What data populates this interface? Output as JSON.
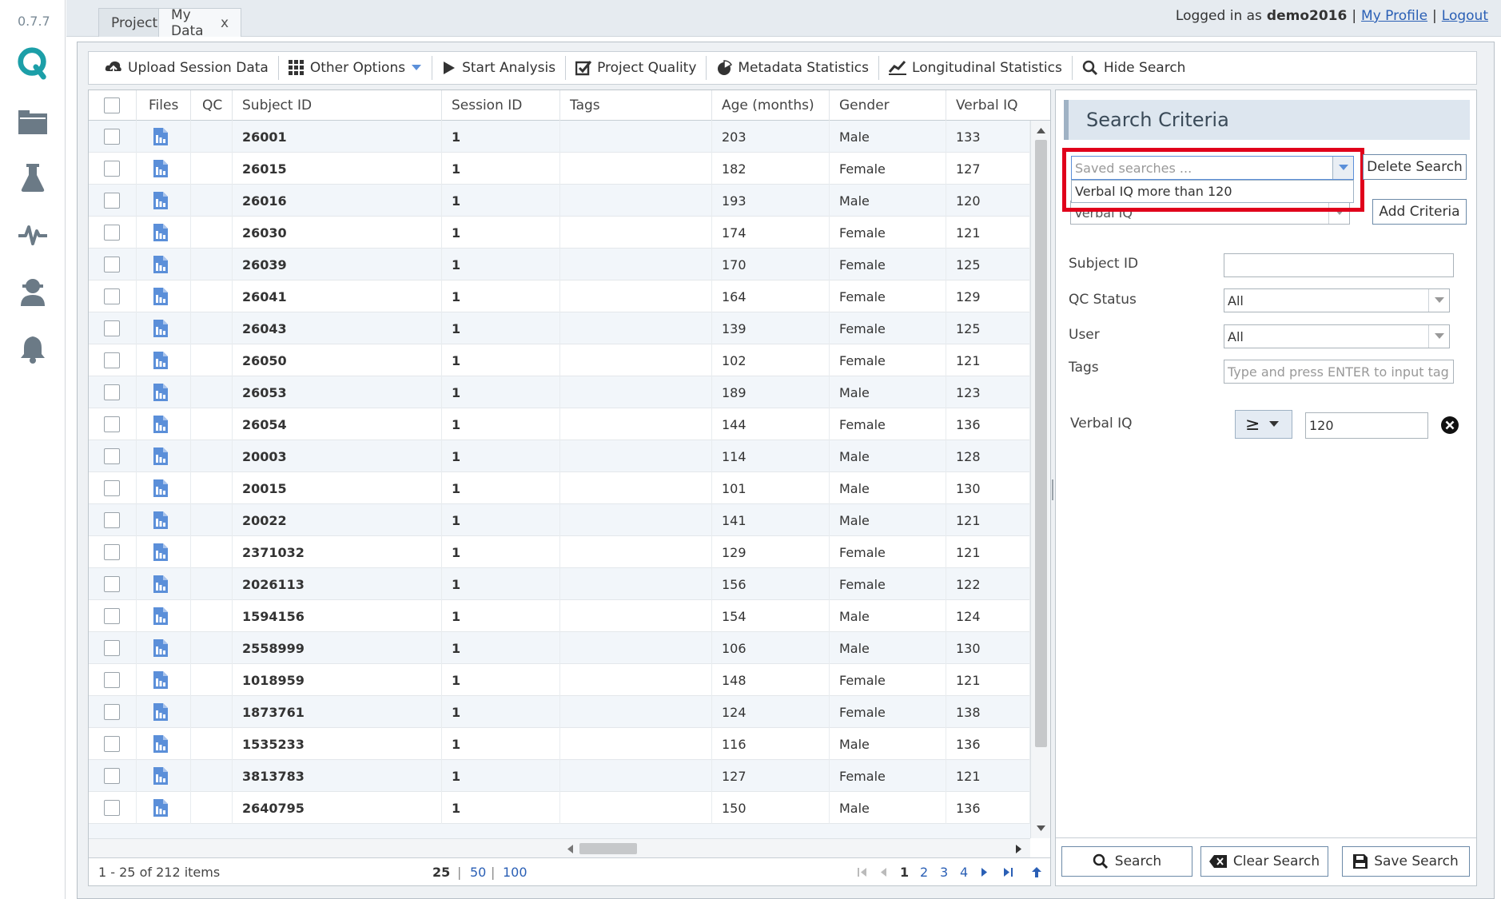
{
  "app": {
    "version": "0.7.7"
  },
  "tabs": [
    {
      "label": "Projects"
    },
    {
      "label": "My Data",
      "close": "x"
    }
  ],
  "login": {
    "prefix": "Logged in as",
    "user": "demo2016",
    "sep": "|",
    "profile": "My Profile",
    "logout": "Logout"
  },
  "toolbar": {
    "upload": "Upload Session Data",
    "other": "Other Options",
    "start": "Start Analysis",
    "quality": "Project Quality",
    "metadata": "Metadata Statistics",
    "longitudinal": "Longitudinal Statistics",
    "hide": "Hide Search"
  },
  "grid": {
    "columns": {
      "files": "Files",
      "qc": "QC",
      "subject": "Subject ID",
      "session": "Session ID",
      "tags": "Tags",
      "age": "Age (months)",
      "gender": "Gender",
      "viq": "Verbal IQ"
    },
    "rows": [
      {
        "subject": "26001",
        "session": "1",
        "age": "203",
        "gender": "Male",
        "viq": "133"
      },
      {
        "subject": "26015",
        "session": "1",
        "age": "182",
        "gender": "Female",
        "viq": "127"
      },
      {
        "subject": "26016",
        "session": "1",
        "age": "193",
        "gender": "Male",
        "viq": "120"
      },
      {
        "subject": "26030",
        "session": "1",
        "age": "174",
        "gender": "Female",
        "viq": "121"
      },
      {
        "subject": "26039",
        "session": "1",
        "age": "170",
        "gender": "Female",
        "viq": "125"
      },
      {
        "subject": "26041",
        "session": "1",
        "age": "164",
        "gender": "Female",
        "viq": "129"
      },
      {
        "subject": "26043",
        "session": "1",
        "age": "139",
        "gender": "Female",
        "viq": "125"
      },
      {
        "subject": "26050",
        "session": "1",
        "age": "102",
        "gender": "Female",
        "viq": "121"
      },
      {
        "subject": "26053",
        "session": "1",
        "age": "189",
        "gender": "Male",
        "viq": "123"
      },
      {
        "subject": "26054",
        "session": "1",
        "age": "144",
        "gender": "Female",
        "viq": "136"
      },
      {
        "subject": "20003",
        "session": "1",
        "age": "114",
        "gender": "Male",
        "viq": "128"
      },
      {
        "subject": "20015",
        "session": "1",
        "age": "101",
        "gender": "Male",
        "viq": "130"
      },
      {
        "subject": "20022",
        "session": "1",
        "age": "141",
        "gender": "Male",
        "viq": "121"
      },
      {
        "subject": "2371032",
        "session": "1",
        "age": "129",
        "gender": "Female",
        "viq": "121"
      },
      {
        "subject": "2026113",
        "session": "1",
        "age": "156",
        "gender": "Female",
        "viq": "122"
      },
      {
        "subject": "1594156",
        "session": "1",
        "age": "154",
        "gender": "Male",
        "viq": "124"
      },
      {
        "subject": "2558999",
        "session": "1",
        "age": "106",
        "gender": "Male",
        "viq": "130"
      },
      {
        "subject": "1018959",
        "session": "1",
        "age": "148",
        "gender": "Female",
        "viq": "121"
      },
      {
        "subject": "1873761",
        "session": "1",
        "age": "124",
        "gender": "Female",
        "viq": "138"
      },
      {
        "subject": "1535233",
        "session": "1",
        "age": "116",
        "gender": "Male",
        "viq": "136"
      },
      {
        "subject": "3813783",
        "session": "1",
        "age": "127",
        "gender": "Female",
        "viq": "121"
      },
      {
        "subject": "2640795",
        "session": "1",
        "age": "150",
        "gender": "Male",
        "viq": "136"
      }
    ]
  },
  "pager": {
    "summary": "1 - 25 of 212 items",
    "sizes": [
      "25",
      "50",
      "100"
    ],
    "sep": "|",
    "pages": [
      "1",
      "2",
      "3",
      "4"
    ],
    "current": "1"
  },
  "search": {
    "title": "Search Criteria",
    "saved_placeholder": "Saved searches ...",
    "saved_option": "Verbal IQ more than 120",
    "criteria_hidden": "Verbal IQ",
    "delete": "Delete Search",
    "add": "Add Criteria",
    "subject_label": "Subject ID",
    "qc_label": "QC Status",
    "qc_value": "All",
    "user_label": "User",
    "user_value": "All",
    "tags_label": "Tags",
    "tags_placeholder": "Type and press ENTER to input tag",
    "viq_label": "Verbal IQ",
    "viq_op": "≥",
    "viq_value": "120",
    "btn_search": "Search",
    "btn_clear": "Clear Search",
    "btn_save": "Save Search"
  },
  "colors": {
    "accent": "#5b8fd9",
    "highlight": "#e0001b",
    "logo": "#1c9fa8"
  },
  "icons": [
    "logo-icon",
    "folder-icon",
    "flask-icon",
    "pulse-icon",
    "user-icon",
    "bell-icon",
    "file-icon"
  ]
}
